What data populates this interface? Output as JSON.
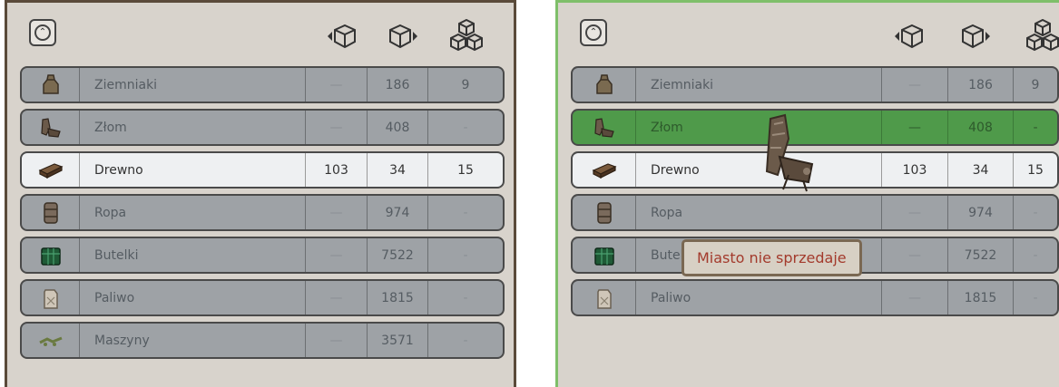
{
  "header_icons": [
    "collapse-arrows-icon",
    "buy-box-icon",
    "sell-box-icon",
    "stock-boxes-icon"
  ],
  "left_panel": {
    "rows": [
      {
        "icon": "potato-sack-icon",
        "name": "Ziemniaki",
        "buy": "—",
        "sell": "186",
        "stock": "9",
        "state": "normal"
      },
      {
        "icon": "scrap-icon",
        "name": "Złom",
        "buy": "—",
        "sell": "408",
        "stock": "-",
        "state": "normal"
      },
      {
        "icon": "wood-icon",
        "name": "Drewno",
        "buy": "103",
        "sell": "34",
        "stock": "15",
        "state": "selected"
      },
      {
        "icon": "oil-barrel-icon",
        "name": "Ropa",
        "buy": "—",
        "sell": "974",
        "stock": "-",
        "state": "normal"
      },
      {
        "icon": "bottles-crate-icon",
        "name": "Butelki",
        "buy": "—",
        "sell": "7522",
        "stock": "-",
        "state": "normal"
      },
      {
        "icon": "fuel-can-icon",
        "name": "Paliwo",
        "buy": "—",
        "sell": "1815",
        "stock": "-",
        "state": "normal"
      },
      {
        "icon": "machines-icon",
        "name": "Maszyny",
        "buy": "—",
        "sell": "3571",
        "stock": "-",
        "state": "normal"
      }
    ]
  },
  "right_panel": {
    "rows": [
      {
        "icon": "potato-sack-icon",
        "name": "Ziemniaki",
        "buy": "—",
        "sell": "186",
        "stock": "9",
        "state": "normal"
      },
      {
        "icon": "scrap-icon",
        "name": "Złom",
        "buy": "—",
        "sell": "408",
        "stock": "-",
        "state": "hovered"
      },
      {
        "icon": "wood-icon",
        "name": "Drewno",
        "buy": "103",
        "sell": "34",
        "stock": "15",
        "state": "selected"
      },
      {
        "icon": "oil-barrel-icon",
        "name": "Ropa",
        "buy": "—",
        "sell": "974",
        "stock": "-",
        "state": "normal"
      },
      {
        "icon": "bottles-crate-icon",
        "name": "Butelki",
        "buy": "—",
        "sell": "7522",
        "stock": "-",
        "state": "normal"
      },
      {
        "icon": "fuel-can-icon",
        "name": "Paliwo",
        "buy": "—",
        "sell": "1815",
        "stock": "-",
        "state": "normal"
      }
    ],
    "tooltip": "Miasto nie sprzedaje",
    "dragged_item_icon": "scrap-icon"
  },
  "colors": {
    "panel_bg": "#d8d3cc",
    "row_bg": "#9ea2a6",
    "selected_row_bg": "#eef0f2",
    "hover_row_bg": "#4f9a4a",
    "drop_target_border": "#7fbf6a",
    "tooltip_text": "#a33a2c"
  }
}
